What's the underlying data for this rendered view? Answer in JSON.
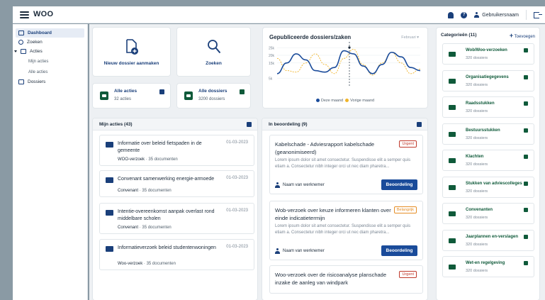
{
  "app": {
    "title": "WOO"
  },
  "header": {
    "user_name": "Gebruikersnaam"
  },
  "colors": {
    "primary": "#1a3f7a",
    "green": "#0f5a3a",
    "urgent": "#c0392b",
    "important": "#e58e26"
  },
  "sidebar": {
    "items": [
      {
        "label": "Dashboard",
        "icon": "dashboard-icon"
      },
      {
        "label": "Zoeken",
        "icon": "search-icon"
      },
      {
        "label": "Acties",
        "icon": "inbox-icon"
      },
      {
        "label": "Mijn acties"
      },
      {
        "label": "Alle acties"
      },
      {
        "label": "Dossiers",
        "icon": "folder-icon"
      }
    ]
  },
  "tiles": {
    "new_dossier": "Nieuw dossier aanmaken",
    "search": "Zoeken"
  },
  "stats": [
    {
      "label": "Alle acties",
      "count": "32 acties"
    },
    {
      "label": "Alle dossiers",
      "count": "3200 dossiers"
    }
  ],
  "chart_panel": {
    "title": "Gepubliceerde dossiers/zaken",
    "month": "Februari",
    "legend_current": "Deze maand",
    "legend_previous": "Vorige maand"
  },
  "chart_data": {
    "type": "line",
    "title": "Gepubliceerde dossiers/zaken",
    "y_ticks": [
      "25k",
      "20k",
      "15k",
      "5k"
    ],
    "ylim": [
      0,
      27000
    ],
    "series": [
      {
        "name": "Deze maand",
        "color": "#1a4b9a",
        "values": [
          8000,
          15000,
          21000,
          17000,
          10000,
          9000,
          12000,
          23000,
          21000,
          13000,
          8000,
          14000,
          22000,
          19000,
          12000,
          10000
        ]
      },
      {
        "name": "Vorige maand",
        "color": "#f0b429",
        "values": [
          18000,
          10000,
          9000,
          15000,
          21000,
          14000,
          8000,
          18000,
          24000,
          14000,
          7000,
          15000,
          22000,
          15000,
          8000,
          11000
        ]
      }
    ]
  },
  "my_actions": {
    "title": "Mijn acties (43)",
    "items": [
      {
        "title": "Informatie over beleid fietspaden in de gemeente",
        "date": "01-03-2023",
        "type": "WOO-verzoek",
        "docs": "35 documenten"
      },
      {
        "title": "Convenant samenwerking energie-armoede",
        "date": "01-03-2023",
        "type": "Convenant",
        "docs": "35 documenten"
      },
      {
        "title": "Intentie-overeenkomst aanpak overlast rond middelbare scholen",
        "date": "01-03-2023",
        "type": "Convenant",
        "docs": "35 documenten"
      },
      {
        "title": "Informatieverzoek beleid studentenwoningen",
        "date": "01-03-2023",
        "type": "Woo-verzoek",
        "docs": "35 documenten"
      }
    ]
  },
  "review": {
    "title": "In beoordeling (9)",
    "items": [
      {
        "title": "Kabelschade - Adviesrapport kabelschade (geanonimiseerd)",
        "badge": "Urgent",
        "desc": "Lorem ipsum dolor sit amet consectetur. Suspendisse elit a semper quis etiam a. Consectetur nibh integer orci ut nec diam pharetra...",
        "employee": "Naam van werknemer",
        "button": "Beoordeling"
      },
      {
        "title": "Wob-verzoek over keuze informeren klanten over einde indicatietermijn",
        "badge": "Belangrijk",
        "desc": "Lorem ipsum dolor sit amet consectetur. Suspendisse elit a semper quis etiam a. Consectetur nibh integer orci ut nec diam pharetra...",
        "employee": "Naam van werknemer",
        "button": "Beoordeling"
      },
      {
        "title": "Woo-verzoek over de risicoanalyse planschade inzake de aanleg van windpark",
        "badge": "Urgent"
      }
    ]
  },
  "categories": {
    "title": "Categorieën (11)",
    "add": "Toevoegen",
    "items": [
      {
        "name": "Wob/Woo-verzoeken",
        "count": "320 dossiers"
      },
      {
        "name": "Organisatiegegevens",
        "count": "320 dossiers"
      },
      {
        "name": "Raadsstukken",
        "count": "320 dossiers"
      },
      {
        "name": "Bestuursstukken",
        "count": "320 dossiers"
      },
      {
        "name": "Klachten",
        "count": "320 dossiers"
      },
      {
        "name": "Stukken van adviescolleges",
        "count": "320 dossiers"
      },
      {
        "name": "Convenanten",
        "count": "320 dossiers"
      },
      {
        "name": "Jaarplannen en-verslagen",
        "count": "320 dossiers"
      },
      {
        "name": "Wet-en regelgeving",
        "count": "320 dossiers"
      }
    ]
  }
}
